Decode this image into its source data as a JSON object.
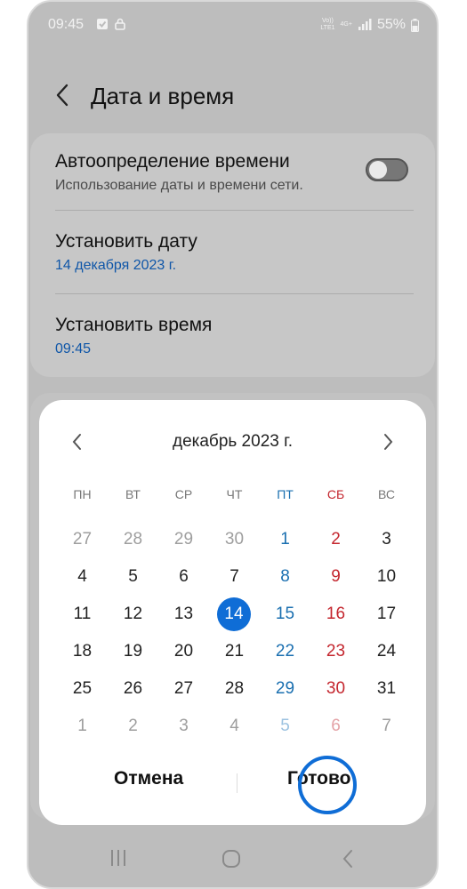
{
  "status_bar": {
    "time": "09:45",
    "battery": "55%",
    "signal_label_top": "Vo))",
    "signal_label_bottom": "LTE1",
    "net_label": "4G+"
  },
  "header": {
    "title": "Дата и время"
  },
  "settings": {
    "auto_time": {
      "title": "Автоопределение времени",
      "subtitle": "Использование даты и времени сети."
    },
    "set_date": {
      "title": "Установить дату",
      "value": "14 декабря 2023 г."
    },
    "set_time": {
      "title": "Установить время",
      "value": "09:45"
    }
  },
  "calendar": {
    "month_label": "декабрь 2023 г.",
    "weekdays": [
      "ПН",
      "ВТ",
      "СР",
      "ЧТ",
      "ПТ",
      "СБ",
      "ВС"
    ],
    "weeks": [
      [
        "27",
        "28",
        "29",
        "30",
        "1",
        "2",
        "3"
      ],
      [
        "4",
        "5",
        "6",
        "7",
        "8",
        "9",
        "10"
      ],
      [
        "11",
        "12",
        "13",
        "14",
        "15",
        "16",
        "17"
      ],
      [
        "18",
        "19",
        "20",
        "21",
        "22",
        "23",
        "24"
      ],
      [
        "25",
        "26",
        "27",
        "28",
        "29",
        "30",
        "31"
      ],
      [
        "1",
        "2",
        "3",
        "4",
        "5",
        "6",
        "7"
      ]
    ],
    "selected_day": "14",
    "cancel_label": "Отмена",
    "done_label": "Готово"
  },
  "colors": {
    "accent": "#0f6dd6",
    "friday": "#1a6fb0",
    "saturday": "#c4262e"
  }
}
